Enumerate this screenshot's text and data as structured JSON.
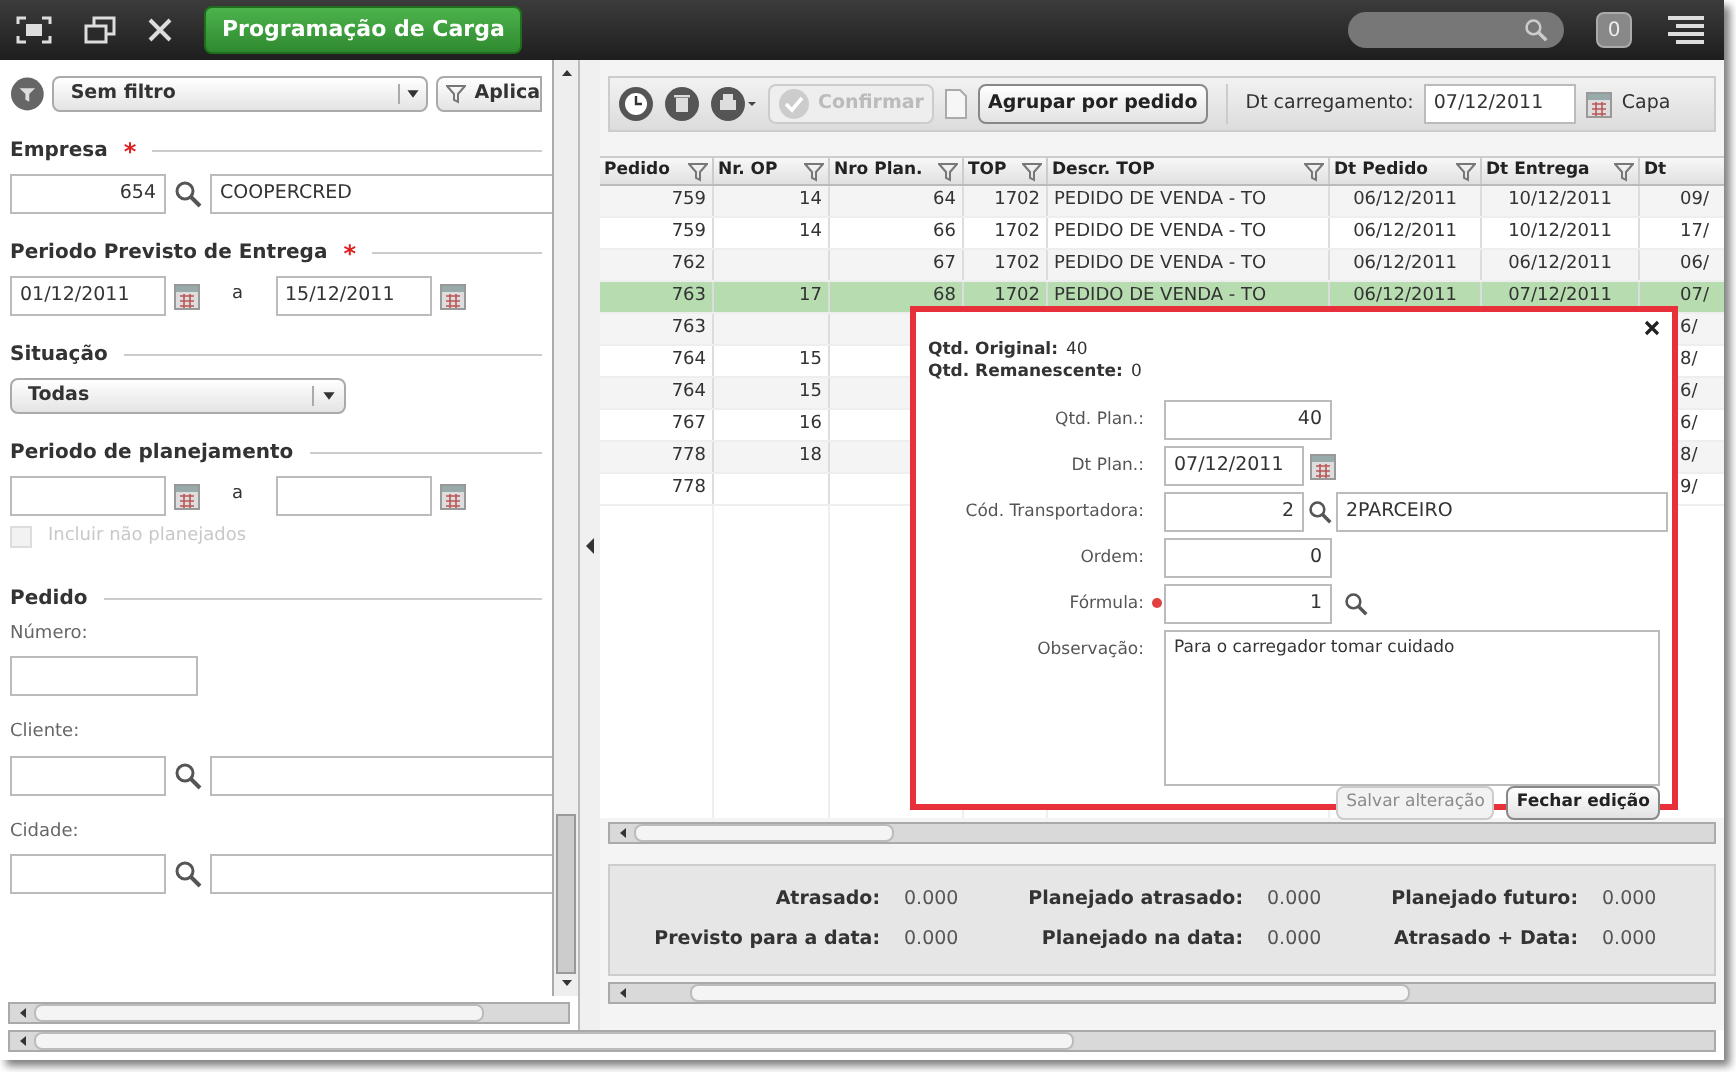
{
  "window": {
    "title": "Programação de Carga",
    "notification_count": "0"
  },
  "filter_panel": {
    "filter_select": "Sem filtro",
    "apply_button": "Aplica",
    "empresa": {
      "label": "Empresa",
      "required_mark": "*",
      "code": "654",
      "name": "COOPERCRED"
    },
    "periodo_entrega": {
      "label": "Periodo Previsto de Entrega",
      "required_mark": "*",
      "from": "01/12/2011",
      "separator": "a",
      "to": "15/12/2011"
    },
    "situacao": {
      "label": "Situação",
      "value": "Todas"
    },
    "periodo_planejamento": {
      "label": "Periodo de planejamento",
      "separator": "a",
      "include_unplanned": {
        "label": "Incluir não planejados",
        "checked": false,
        "disabled": true
      }
    },
    "pedido": {
      "label": "Pedido",
      "numero_label": "Número:",
      "cliente_label": "Cliente:",
      "cidade_label": "Cidade:"
    }
  },
  "toolbar": {
    "confirm_button": {
      "label": "Confirmar",
      "disabled": true
    },
    "group_button": "Agrupar por pedido",
    "date_label": "Dt carregamento:",
    "date_value": "07/12/2011",
    "cut_label": "Capa"
  },
  "table": {
    "columns": [
      "Pedido",
      "Nr. OP",
      "Nro Plan.",
      "TOP",
      "Descr. TOP",
      "Dt Pedido",
      "Dt Entrega",
      "Dt"
    ],
    "rows": [
      {
        "selected": false,
        "cells": [
          "759",
          "14",
          "64",
          "1702",
          "PEDIDO DE VENDA - TO",
          "06/12/2011",
          "10/12/2011",
          "09/"
        ]
      },
      {
        "selected": false,
        "cells": [
          "759",
          "14",
          "66",
          "1702",
          "PEDIDO DE VENDA - TO",
          "06/12/2011",
          "10/12/2011",
          "17/"
        ]
      },
      {
        "selected": false,
        "cells": [
          "762",
          null,
          "67",
          "1702",
          "PEDIDO DE VENDA - TO",
          "06/12/2011",
          "06/12/2011",
          "06/"
        ]
      },
      {
        "selected": true,
        "cells": [
          "763",
          "17",
          "68",
          "1702",
          "PEDIDO DE VENDA - TO",
          "06/12/2011",
          "07/12/2011",
          "07/"
        ]
      },
      {
        "selected": false,
        "cells": [
          "763",
          null,
          null,
          null,
          null,
          null,
          null,
          "6/"
        ]
      },
      {
        "selected": false,
        "cells": [
          "764",
          "15",
          null,
          null,
          null,
          null,
          null,
          "8/"
        ]
      },
      {
        "selected": false,
        "cells": [
          "764",
          "15",
          null,
          null,
          null,
          null,
          null,
          "6/"
        ]
      },
      {
        "selected": false,
        "cells": [
          "767",
          "16",
          null,
          null,
          null,
          null,
          null,
          "6/"
        ]
      },
      {
        "selected": false,
        "cells": [
          "778",
          "18",
          null,
          null,
          null,
          null,
          null,
          "8/"
        ]
      },
      {
        "selected": false,
        "cells": [
          "778",
          null,
          null,
          null,
          null,
          null,
          null,
          "9/"
        ]
      }
    ]
  },
  "edit_dialog": {
    "original_label": "Qtd. Original:",
    "original_value": "40",
    "remaining_label": "Qtd. Remanescente:",
    "remaining_value": "0",
    "fields": [
      {
        "kind": "number",
        "label": "Qtd. Plan.:",
        "value": "40",
        "required": false
      },
      {
        "kind": "date",
        "label": "Dt Plan.:",
        "value": "07/12/2011",
        "required": false
      },
      {
        "kind": "lookup",
        "label": "Cód. Transportadora:",
        "value": "2",
        "description": "2PARCEIRO",
        "required": false
      },
      {
        "kind": "number",
        "label": "Ordem:",
        "value": "0",
        "required": false
      },
      {
        "kind": "search",
        "label": "Fórmula:",
        "value": "1",
        "required": true
      },
      {
        "kind": "textarea",
        "label": "Observação:",
        "value": "Para o carregador tomar cuidado",
        "required": false
      }
    ],
    "save_button": {
      "label": "Salvar alteração",
      "disabled": true
    },
    "close_edit_button": "Fechar edição"
  },
  "summary": [
    {
      "label": "Atrasado:",
      "value": "0.000"
    },
    {
      "label": "Planejado atrasado:",
      "value": "0.000"
    },
    {
      "label": "Planejado futuro:",
      "value": "0.000"
    },
    {
      "label": "Previsto para a data:",
      "value": "0.000"
    },
    {
      "label": "Planejado na data:",
      "value": "0.000"
    },
    {
      "label": "Atrasado + Data:",
      "value": "0.000"
    }
  ]
}
